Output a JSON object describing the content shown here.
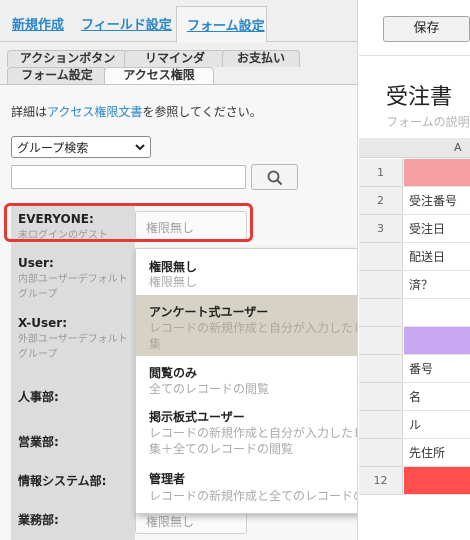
{
  "top_tabs": [
    "新規作成",
    "フィールド設定",
    "フォーム設定"
  ],
  "sub_tabs_row1": [
    "アクションボタン",
    "リマインダ",
    "お支払い"
  ],
  "sub_tabs_row2": [
    "フォーム設定",
    "アクセス権限"
  ],
  "help": {
    "prefix": "詳細は",
    "link": "アクセス権限文書",
    "suffix": "を参照してください。"
  },
  "group_search": {
    "selected": "グループ検索"
  },
  "search_input": {
    "value": ""
  },
  "roles": [
    {
      "name": "EVERYONE:",
      "desc": "未ログインのゲスト",
      "permission": "権限無し"
    },
    {
      "name": "User:",
      "desc": "内部ユーザーデフォルトグループ",
      "permission": ""
    },
    {
      "name": "X-User:",
      "desc": "外部ユーザーデフォルトグループ",
      "permission": ""
    },
    {
      "name": "人事部:",
      "desc": "",
      "permission": ""
    },
    {
      "name": "営業部:",
      "desc": "",
      "permission": ""
    },
    {
      "name": "情報システム部:",
      "desc": "",
      "permission": ""
    },
    {
      "name": "業務部:",
      "desc": "",
      "permission": "権限無し"
    }
  ],
  "permission_options": [
    {
      "title": "権限無し",
      "desc": "権限無し",
      "selected": false
    },
    {
      "title": "アンケート式ユーザー",
      "desc": "レコードの新規作成と自分が入力したレコードの編集",
      "selected": true
    },
    {
      "title": "閲覧のみ",
      "desc": "全てのレコードの閲覧",
      "selected": false
    },
    {
      "title": "掲示板式ユーザー",
      "desc": "レコードの新規作成と自分が入力したレコードの編集＋全てのレコードの閲覧",
      "selected": false
    },
    {
      "title": "管理者",
      "desc": "レコードの新規作成と全てのレコードの編集",
      "selected": false
    }
  ],
  "preview": {
    "save_label": "保存",
    "form_title": "受注書",
    "form_desc": "フォームの説明",
    "column_header": "A",
    "rows": [
      {
        "num": "1",
        "text": "",
        "color": "#f7a0a3"
      },
      {
        "num": "2",
        "text": "受注番号",
        "color": ""
      },
      {
        "num": "3",
        "text": "受注日",
        "color": ""
      },
      {
        "num": "",
        "text": "配送日",
        "color": ""
      },
      {
        "num": "",
        "text": "済？",
        "color": ""
      },
      {
        "num": "",
        "text": "",
        "color": ""
      },
      {
        "num": "",
        "text": "",
        "color": "#c9a7f0"
      },
      {
        "num": "",
        "text": "番号",
        "color": ""
      },
      {
        "num": "",
        "text": "名",
        "color": ""
      },
      {
        "num": "",
        "text": "ル",
        "color": ""
      },
      {
        "num": "",
        "text": "先住所",
        "color": ""
      },
      {
        "num": "12",
        "text": "",
        "color": "#ff4e4e"
      }
    ]
  }
}
